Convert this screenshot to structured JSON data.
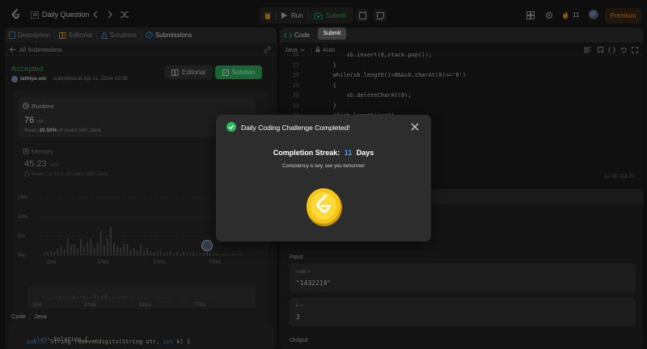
{
  "topbar": {
    "problem_list_label": "Daily Question",
    "run_label": "Run",
    "submit_label": "Submit",
    "streak_count": "11",
    "premium_label": "Premium",
    "submit_tooltip": "Submit"
  },
  "left_panel": {
    "tabs": [
      "Description",
      "Editorial",
      "Solutions",
      "Submissions"
    ],
    "back_label": "All Submissions",
    "status": "Accepted",
    "user": "lathiya om",
    "submitted_text": "submitted at Apr 11, 2024 15:08",
    "editorial_button": "Editorial",
    "solution_button": "Solution",
    "runtime": {
      "title": "Runtime",
      "value": "76",
      "unit": "ms",
      "beats_prefix": "Beats",
      "beats_value": "20.50%",
      "beats_suffix": "of users with Java"
    },
    "memory": {
      "title": "Memory",
      "value": "45.23",
      "unit": "MB",
      "beats_prefix": "Beats",
      "beats_value": "53.41%",
      "beats_suffix": "of users with Java"
    },
    "code_header": {
      "label": "Code",
      "language": "Java"
    },
    "code_lines": [
      "class Solution {",
      "    public String removeKdigits(String str, int k) {"
    ]
  },
  "chart_data": {
    "type": "bar",
    "title": "",
    "xlabel": "",
    "ylabel": "",
    "x_ticks": [
      "2ms",
      "27ms",
      "52ms",
      "77ms"
    ],
    "y_ticks": [
      "15%",
      "10%",
      "5%",
      "0%"
    ],
    "ylim": [
      0,
      15
    ],
    "xlim": [
      2,
      100
    ],
    "values": [
      0.6,
      0.9,
      1.2,
      0.8,
      1.6,
      2.2,
      1.4,
      4.4,
      2.6,
      2.8,
      1.8,
      4.1,
      2.4,
      3.4,
      4.3,
      2.0,
      3.2,
      6.3,
      2.6,
      4.4,
      7.3,
      3.2,
      2.4,
      2.0,
      2.9,
      3.0,
      1.4,
      1.8,
      1.3,
      2.7,
      1.2,
      1.9,
      1.0,
      0.8,
      0.9,
      1.4,
      0.6,
      0.8,
      1.0,
      0.5,
      0.9,
      0.4,
      1.0,
      0.6,
      0.5,
      0.8,
      0.3,
      0.4,
      0.6,
      0.3,
      0.7,
      0.3,
      0.5,
      0.2,
      0.4,
      0.3,
      0.2,
      0.4,
      0.2,
      0.3
    ],
    "highlight_x": "76ms",
    "range_ticks": [
      "2ms",
      "27ms",
      "52ms",
      "77ms"
    ],
    "grid": true
  },
  "editor": {
    "tab_label": "Code",
    "language": "Java",
    "mode": "Auto",
    "lines": [
      {
        "n": "26",
        "text": "            sb.insert(0,stack.pop());"
      },
      {
        "n": "27",
        "text": "        }"
      },
      {
        "n": "28",
        "text": "        while(sb.length()>0&&sb.charAt(0)=='0')"
      },
      {
        "n": "29",
        "text": "        {"
      },
      {
        "n": "30",
        "text": "            sb.deleteCharAt(0);"
      },
      {
        "n": "31",
        "text": "        }"
      },
      {
        "n": "32",
        "text": "        if(sb.length()==0)"
      }
    ],
    "cursor_pos": "Ln 16, Col 20"
  },
  "testcase": {
    "input_label": "Input",
    "params": [
      {
        "name": "num =",
        "value": "\"1432219\""
      },
      {
        "name": "k =",
        "value": "3"
      }
    ],
    "output_label": "Output"
  },
  "modal": {
    "title": "Daily Coding Challenge Completed!",
    "streak_label": "Completion Streak:",
    "streak_value": "11",
    "streak_unit": "Days",
    "subtitle": "Consistency is key, see you tomorrow!"
  },
  "colors": {
    "accent_green": "#2cbb5d",
    "brand_orange": "#ffa116",
    "streak_blue": "#3e9bff",
    "coin_gold": "#f5c518"
  }
}
